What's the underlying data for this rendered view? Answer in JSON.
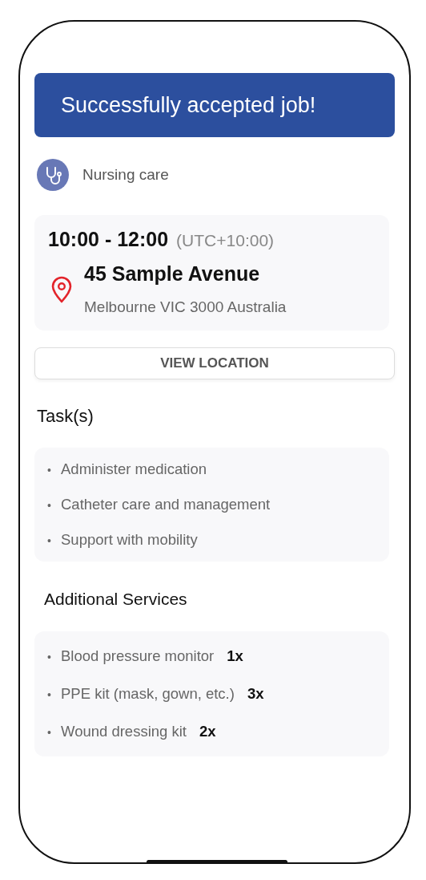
{
  "banner": {
    "text": "Successfully accepted job!"
  },
  "category": {
    "label": "Nursing care"
  },
  "appointment": {
    "time": "10:00 - 12:00",
    "timezone": "(UTC+10:00)",
    "street": "45 Sample Avenue",
    "city": "Melbourne VIC 3000 Australia"
  },
  "view_location_button": {
    "label": "VIEW LOCATION"
  },
  "tasks": {
    "heading": "Task(s)",
    "items": [
      {
        "marker": "•",
        "text": "Administer medication"
      },
      {
        "marker": "•",
        "text": "Catheter care and management"
      },
      {
        "marker": "•",
        "text": "Support with mobility"
      }
    ]
  },
  "additional_services": {
    "heading": "Additional Services",
    "items": [
      {
        "marker": "•",
        "text": "Blood pressure monitor",
        "quantity": "1x"
      },
      {
        "marker": "•",
        "text": "PPE kit (mask, gown, etc.)",
        "quantity": "3x"
      },
      {
        "marker": "•",
        "text": "Wound dressing kit",
        "quantity": "2x"
      }
    ]
  }
}
